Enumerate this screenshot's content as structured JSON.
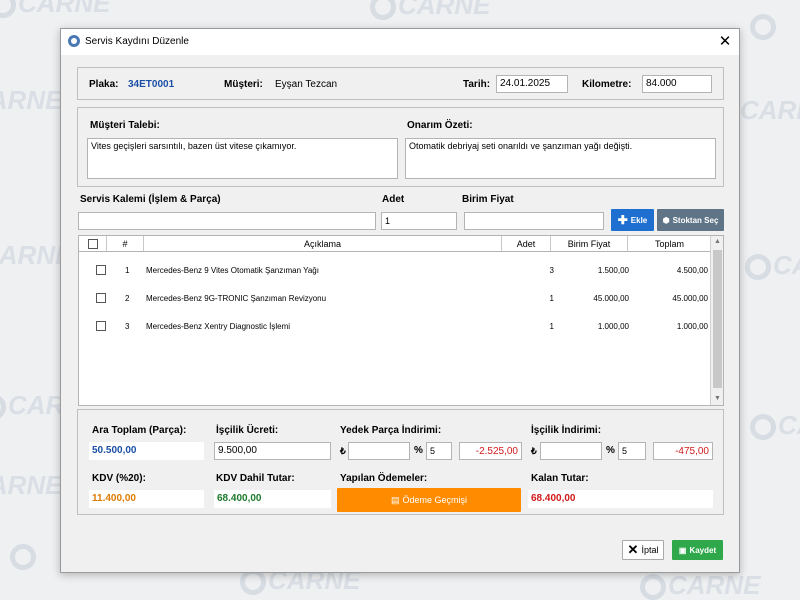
{
  "watermark": "CARNE",
  "window": {
    "title": "Servis Kaydını Düzenle",
    "close": "✕"
  },
  "header": {
    "plate_label": "Plaka:",
    "plate_value": "34ET0001",
    "customer_label": "Müşteri:",
    "customer_value": "Eyşan Tezcan",
    "date_label": "Tarih:",
    "date_value": "24.01.2025",
    "km_label": "Kilometre:",
    "km_value": "84.000"
  },
  "request": {
    "label": "Müşteri Talebi:",
    "value": "Vites geçişleri sarsıntılı, bazen üst vitese çıkamıyor."
  },
  "repair": {
    "label": "Onarım Özeti:",
    "value": "Otomatik debriyaj seti onarıldı ve şanzıman yağı değişti."
  },
  "item_entry": {
    "item_label": "Servis Kalemi (İşlem & Parça)",
    "item_value": "",
    "qty_label": "Adet",
    "qty_value": "1",
    "price_label": "Birim Fiyat",
    "price_value": "",
    "add_button": "Ekle",
    "stock_button": "Stoktan Seç"
  },
  "table": {
    "headers": [
      "#",
      "Açıklama",
      "Adet",
      "Birim Fiyat",
      "Toplam"
    ],
    "rows": [
      {
        "no": "1",
        "desc": "Mercedes-Benz 9 Vites Otomatik Şanzıman Yağı",
        "qty": "3",
        "unit": "1.500,00",
        "total": "4.500,00"
      },
      {
        "no": "2",
        "desc": "Mercedes-Benz 9G-TRONIC Şanzıman Revizyonu",
        "qty": "1",
        "unit": "45.000,00",
        "total": "45.000,00"
      },
      {
        "no": "3",
        "desc": "Mercedes-Benz Xentry Diagnostic İşlemi",
        "qty": "1",
        "unit": "1.000,00",
        "total": "1.000,00"
      }
    ]
  },
  "summary": {
    "subtotal_label": "Ara Toplam (Parça):",
    "subtotal_value": "50.500,00",
    "labor_label": "İşçilik Ücreti:",
    "labor_value": "9.500,00",
    "parts_discount_label": "Yedek Parça İndirimi:",
    "parts_discount_currency": "₺",
    "parts_discount_amount": "",
    "parts_discount_percent_sign": "%",
    "parts_discount_percent": "5",
    "parts_discount_value": "-2.525,00",
    "labor_discount_label": "İşçilik İndirimi:",
    "labor_discount_currency": "₺",
    "labor_discount_amount": "",
    "labor_discount_percent_sign": "%",
    "labor_discount_percent": "5",
    "labor_discount_value": "-475,00",
    "vat_label": "KDV (%20):",
    "vat_value": "11.400,00",
    "vat_incl_label": "KDV Dahil Tutar:",
    "vat_incl_value": "68.400,00",
    "payments_label": "Yapılan Ödemeler:",
    "payments_button": "Ödeme Geçmişi",
    "remaining_label": "Kalan Tutar:",
    "remaining_value": "68.400,00"
  },
  "footer": {
    "cancel": "İptal",
    "save": "Kaydet"
  },
  "colors": {
    "blue_button": "#1f6fd1",
    "gray_button": "#5f7486",
    "orange_button": "#ff8c00",
    "green_button": "#2ea84a",
    "blue_text": "#1b4fa5",
    "orange_text": "#e07b00",
    "green_text": "#1d7a2c",
    "red_text": "#d11a1a"
  }
}
